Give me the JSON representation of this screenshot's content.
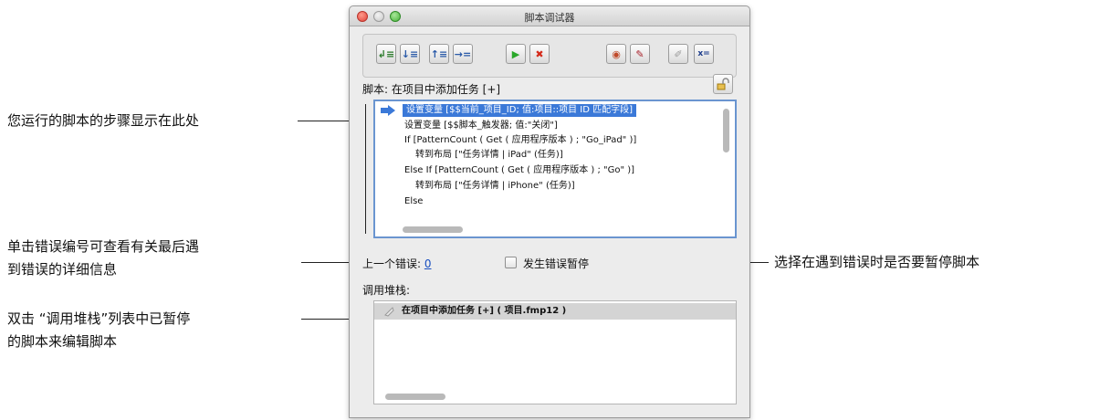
{
  "window": {
    "title": "脚本调试器"
  },
  "toolbar": {
    "buttons": [
      {
        "name": "step-into",
        "glyph": "↲≡"
      },
      {
        "name": "step-over",
        "glyph": "↓≡"
      },
      {
        "name": "step-out",
        "glyph": "↑≡"
      },
      {
        "name": "set-next-step",
        "glyph": "→="
      },
      {
        "name": "run",
        "glyph": "▶"
      },
      {
        "name": "halt",
        "glyph": "✖"
      },
      {
        "name": "breakpoint",
        "glyph": "◉"
      },
      {
        "name": "edit-script",
        "glyph": "✎"
      },
      {
        "name": "edit-breakpoint",
        "glyph": "✐"
      },
      {
        "name": "data-viewer",
        "glyph": "x="
      }
    ]
  },
  "script": {
    "label": "脚本: 在项目中添加任务 [+]",
    "steps": [
      "设置变量 [$$当前_项目_ID; 值:项目::项目 ID 匹配字段]",
      "设置变量 [$$脚本_触发器; 值:\"关闭\"]",
      "If [PatternCount ( Get ( 应用程序版本 ) ; \"Go_iPad\" )]",
      "转到布局 [\"任务详情 | iPad\" (任务)]",
      "Else If [PatternCount ( Get ( 应用程序版本 ) ; \"Go\" )]",
      "转到布局 [\"任务详情 | iPhone\" (任务)]",
      "Else"
    ]
  },
  "last_error": {
    "label": "上一个错误:",
    "value": "0"
  },
  "pause_on_error": {
    "label": "发生错误暂停",
    "checked": false
  },
  "call_stack": {
    "label": "调用堆栈:",
    "items": [
      "在项目中添加任务 [+] ( 项目.fmp12 )"
    ]
  },
  "callouts": {
    "steps": "您运行的脚本的步骤显示在此处",
    "error_line1": "单击错误编号可查看有关最后遇",
    "error_line2": "到错误的详细信息",
    "pause": "选择在遇到错误时是否要暂停脚本",
    "stack_line1": "双击 “调用堆栈”列表中已暂停",
    "stack_line2": "的脚本来编辑脚本"
  },
  "colors": {
    "selection": "#3b79d8",
    "link": "#1a50c0",
    "focus_border": "#6a95d0"
  }
}
